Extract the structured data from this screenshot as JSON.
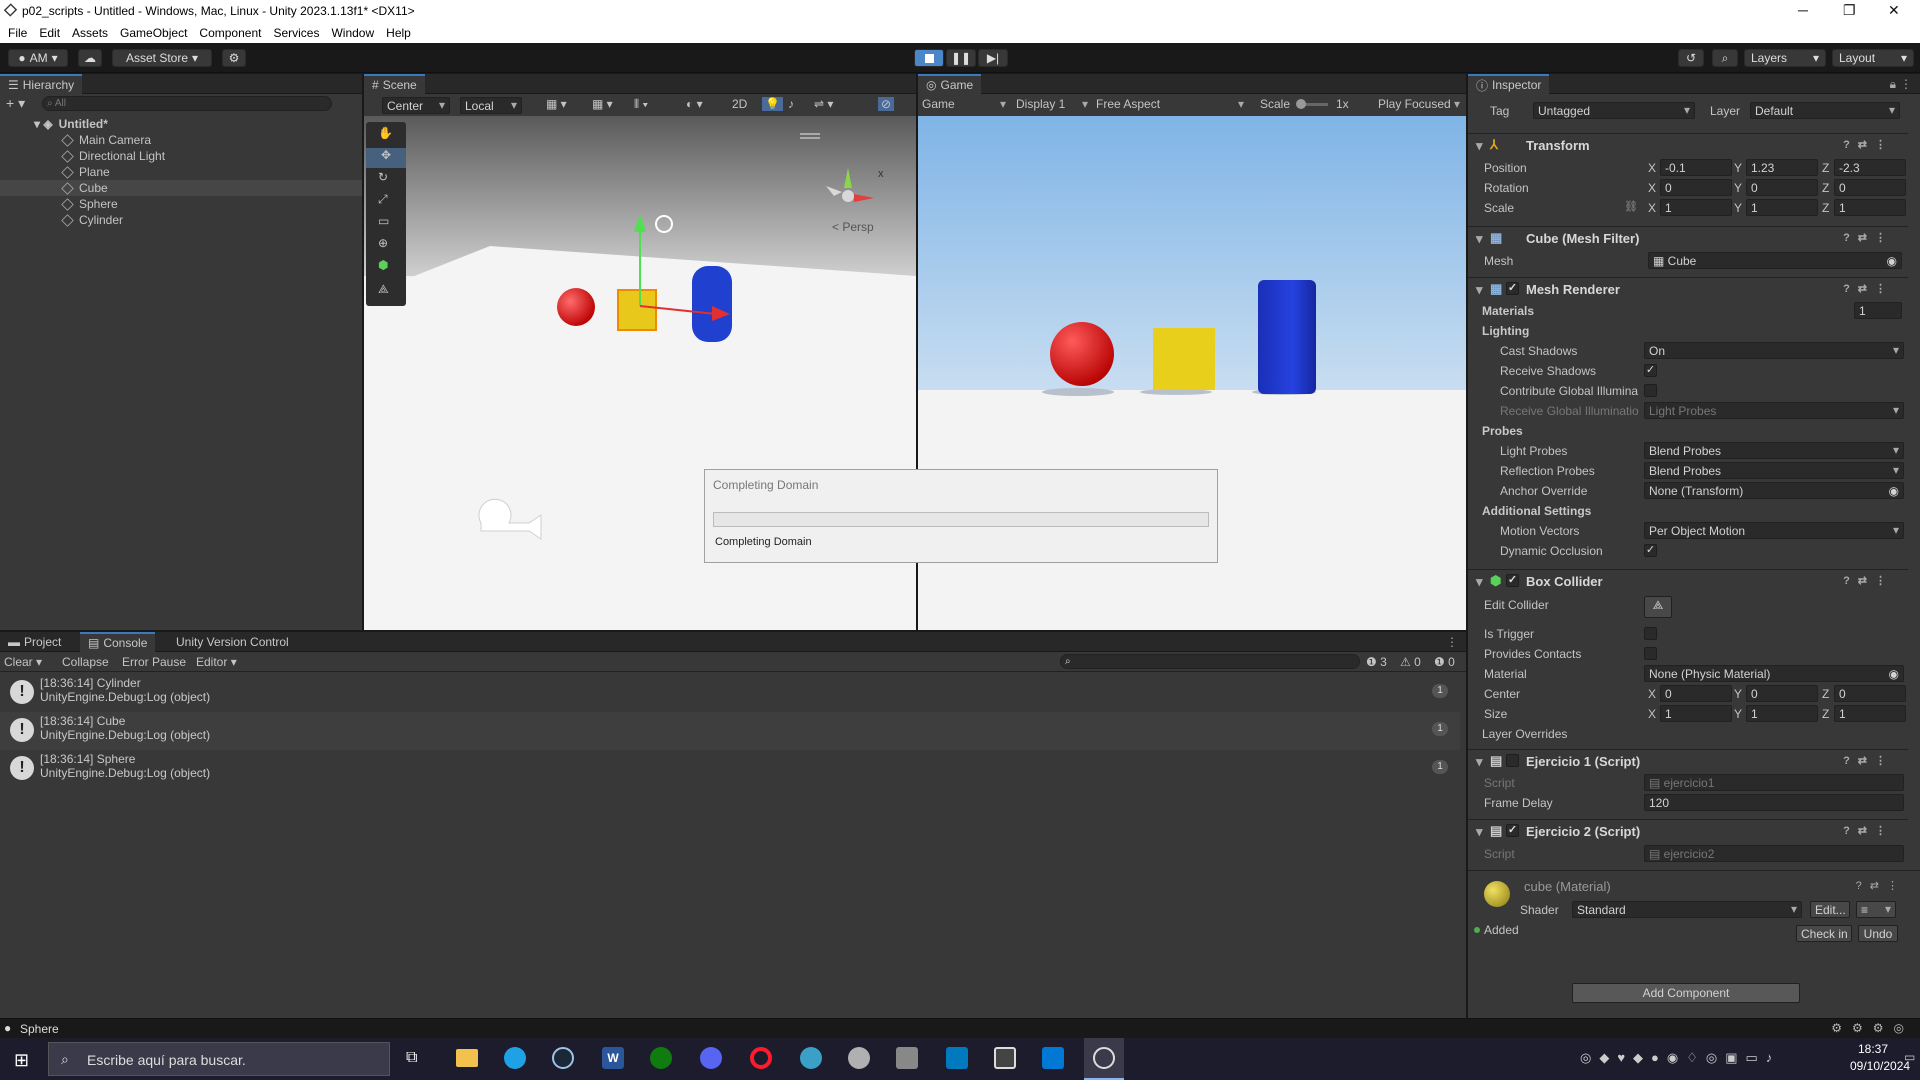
{
  "window": {
    "title": "p02_scripts - Untitled - Windows, Mac, Linux - Unity 2023.1.13f1* <DX11>",
    "minimize": "─",
    "maximize": "❐",
    "close": "✕"
  },
  "menu": [
    "File",
    "Edit",
    "Assets",
    "GameObject",
    "Component",
    "Services",
    "Window",
    "Help"
  ],
  "toolbar": {
    "account": "AM",
    "asset_store": "Asset Store",
    "layers": "Layers",
    "layout": "Layout"
  },
  "hierarchy": {
    "tab": "Hierarchy",
    "search_placeholder": "All",
    "scene": "Untitled*",
    "items": [
      "Main Camera",
      "Directional Light",
      "Plane",
      "Cube",
      "Sphere",
      "Cylinder"
    ]
  },
  "scene_view": {
    "tab": "Scene",
    "pivot": "Center",
    "space": "Local",
    "mode_2d": "2D",
    "persp": "< Persp",
    "gizmo_x": "x"
  },
  "game_view": {
    "tab": "Game",
    "mode": "Game",
    "display": "Display 1",
    "aspect": "Free Aspect",
    "scale_label": "Scale",
    "scale_value": "1x",
    "play_focused": "Play Focused"
  },
  "dialog": {
    "title": "Completing Domain",
    "message": "Completing Domain",
    "progress": 0
  },
  "inspector": {
    "tab": "Inspector",
    "tag_label": "Tag",
    "tag": "Untagged",
    "layer_label": "Layer",
    "layer": "Default",
    "transform": {
      "title": "Transform",
      "position_label": "Position",
      "position": [
        "-0.1",
        "1.23",
        "-2.3"
      ],
      "rotation_label": "Rotation",
      "rotation": [
        "0",
        "0",
        "0"
      ],
      "scale_label": "Scale",
      "scale": [
        "1",
        "1",
        "1"
      ]
    },
    "mesh_filter": {
      "title": "Cube (Mesh Filter)",
      "mesh_label": "Mesh",
      "mesh": "Cube"
    },
    "mesh_renderer": {
      "title": "Mesh Renderer",
      "materials_label": "Materials",
      "materials_count": "1",
      "lighting_label": "Lighting",
      "cast_shadows_label": "Cast Shadows",
      "cast_shadows": "On",
      "receive_shadows_label": "Receive Shadows",
      "contribute_gi_label": "Contribute Global Illumina",
      "receive_gi_label": "Receive Global Illuminatio",
      "receive_gi": "Light Probes",
      "probes_label": "Probes",
      "light_probes_label": "Light Probes",
      "light_probes": "Blend Probes",
      "reflection_probes_label": "Reflection Probes",
      "reflection_probes": "Blend Probes",
      "anchor_label": "Anchor Override",
      "anchor": "None (Transform)",
      "additional_label": "Additional Settings",
      "motion_vectors_label": "Motion Vectors",
      "motion_vectors": "Per Object Motion",
      "dynamic_occlusion_label": "Dynamic Occlusion"
    },
    "box_collider": {
      "title": "Box Collider",
      "edit_label": "Edit Collider",
      "trigger_label": "Is Trigger",
      "contacts_label": "Provides Contacts",
      "material_label": "Material",
      "material": "None (Physic Material)",
      "center_label": "Center",
      "center": [
        "0",
        "0",
        "0"
      ],
      "size_label": "Size",
      "size": [
        "1",
        "1",
        "1"
      ],
      "overrides_label": "Layer Overrides"
    },
    "script1": {
      "title": "Ejercicio 1 (Script)",
      "script_label": "Script",
      "script": "ejercicio1",
      "delay_label": "Frame Delay",
      "delay": "120"
    },
    "script2": {
      "title": "Ejercicio 2 (Script)",
      "script_label": "Script",
      "script": "ejercicio2"
    },
    "material": {
      "title": "cube (Material)",
      "shader_label": "Shader",
      "shader": "Standard",
      "edit": "Edit...",
      "added": "Added",
      "check_in": "Check in",
      "undo": "Undo"
    },
    "add_component": "Add Component"
  },
  "console": {
    "tabs": [
      "Project",
      "Console",
      "Unity Version Control"
    ],
    "clear": "Clear",
    "collapse": "Collapse",
    "error_pause": "Error Pause",
    "editor": "Editor",
    "count_log": "3",
    "count_warn": "0",
    "count_err": "0",
    "entries": [
      {
        "line1": "[18:36:14] Cylinder",
        "line2": "UnityEngine.Debug:Log (object)",
        "count": "1"
      },
      {
        "line1": "[18:36:14] Cube",
        "line2": "UnityEngine.Debug:Log (object)",
        "count": "1"
      },
      {
        "line1": "[18:36:14] Sphere",
        "line2": "UnityEngine.Debug:Log (object)",
        "count": "1"
      }
    ]
  },
  "status": {
    "text": "Sphere"
  },
  "taskbar": {
    "search_placeholder": "Escribe aquí para buscar.",
    "time": "18:37",
    "date": "09/10/2024"
  },
  "colors": {
    "accent": "#3a79bb",
    "sphere": "#d81818",
    "cube": "#e6cf1a",
    "cylinder": "#1f35c8"
  }
}
